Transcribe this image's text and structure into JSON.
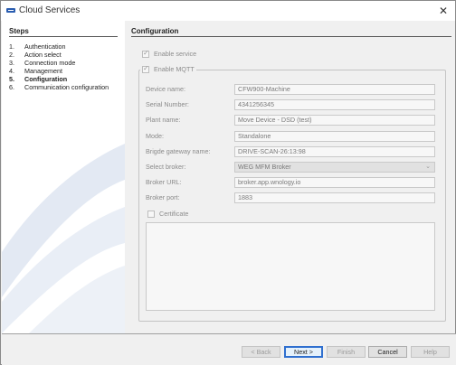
{
  "window": {
    "title": "Cloud Services"
  },
  "steps": {
    "title": "Steps",
    "items": [
      {
        "num": "1.",
        "label": "Authentication",
        "active": false
      },
      {
        "num": "2.",
        "label": "Action select",
        "active": false
      },
      {
        "num": "3.",
        "label": "Connection mode",
        "active": false
      },
      {
        "num": "4.",
        "label": "Management",
        "active": false
      },
      {
        "num": "5.",
        "label": "Configuration",
        "active": true
      },
      {
        "num": "6.",
        "label": "Communication configuration",
        "active": false
      }
    ]
  },
  "config": {
    "title": "Configuration",
    "enable_service": {
      "label": "Enable service",
      "checked": true
    },
    "enable_mqtt": {
      "label": "Enable MQTT",
      "checked": true
    },
    "fields": [
      {
        "label": "Device name:",
        "value": "CFW900-Machine"
      },
      {
        "label": "Serial Number:",
        "value": "4341256345"
      },
      {
        "label": "Plant name:",
        "value": "Move Device - DSD (test)"
      },
      {
        "label": "Mode:",
        "value": "Standalone"
      },
      {
        "label": "Brigde gateway name:",
        "value": "DRIVE-SCAN-26:13:98"
      },
      {
        "label": "Select broker:",
        "value": "WEG MFM Broker"
      },
      {
        "label": "Broker URL:",
        "value": "broker.app.wnology.io"
      },
      {
        "label": "Broker port:",
        "value": "1883"
      }
    ],
    "certificate": {
      "label": "Certificate",
      "checked": false
    }
  },
  "buttons": {
    "back": "< Back",
    "next": "Next >",
    "finish": "Finish",
    "cancel": "Cancel",
    "help": "Help"
  },
  "colors": {
    "accent": "#2f6fcf",
    "swoosh": "#dde4f0"
  }
}
